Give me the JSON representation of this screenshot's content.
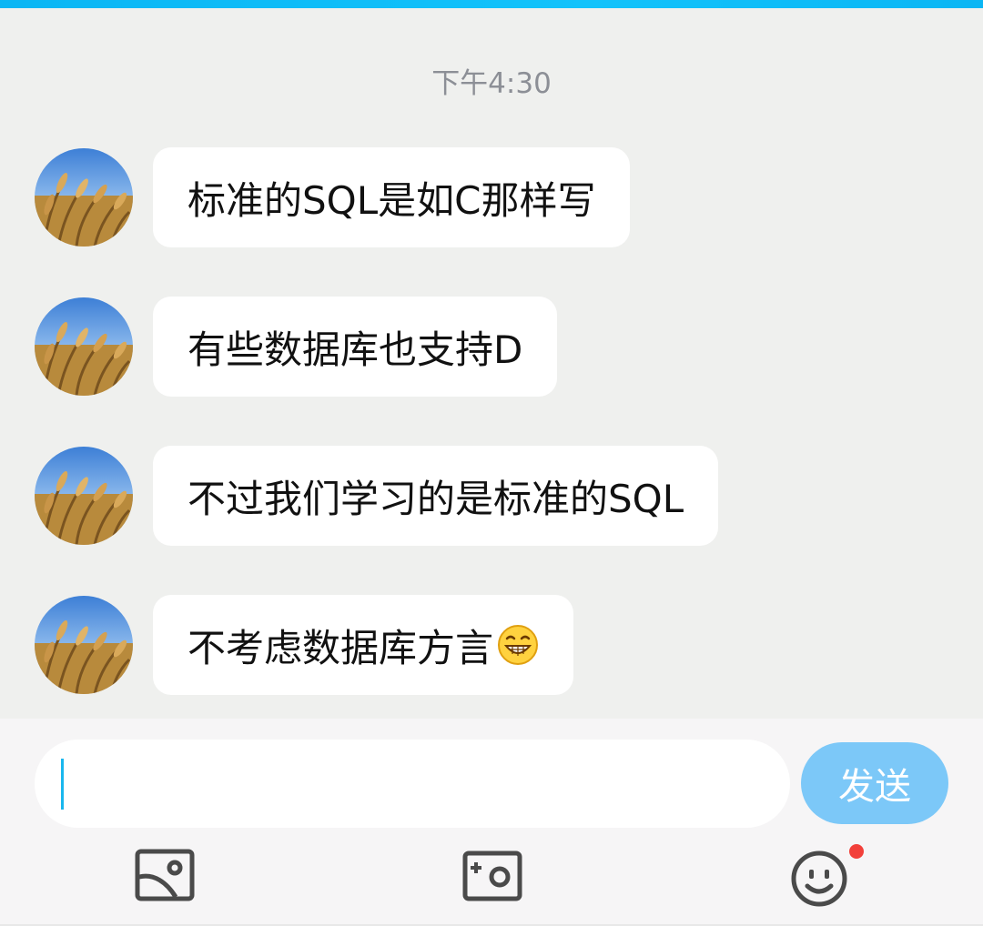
{
  "header": {
    "timestamp": "下午4:30"
  },
  "messages": [
    {
      "text": "标准的SQL是如C那样写",
      "has_emoji": false
    },
    {
      "text": "有些数据库也支持D",
      "has_emoji": false
    },
    {
      "text": "不过我们学习的是标准的SQL",
      "has_emoji": false
    },
    {
      "text": "不考虑数据库方言",
      "emoji": "grinning-face-emoji"
    }
  ],
  "input": {
    "value": "",
    "placeholder": ""
  },
  "send_button": {
    "label": "发送"
  },
  "toolbar": {
    "items": [
      "image-icon",
      "camera-icon",
      "smiley-icon"
    ],
    "smiley_has_notification": true
  },
  "colors": {
    "accent": "#0ab6f4",
    "send_button": "#7cc8f8",
    "badge": "#f2403a",
    "background": "#eff0ee"
  }
}
